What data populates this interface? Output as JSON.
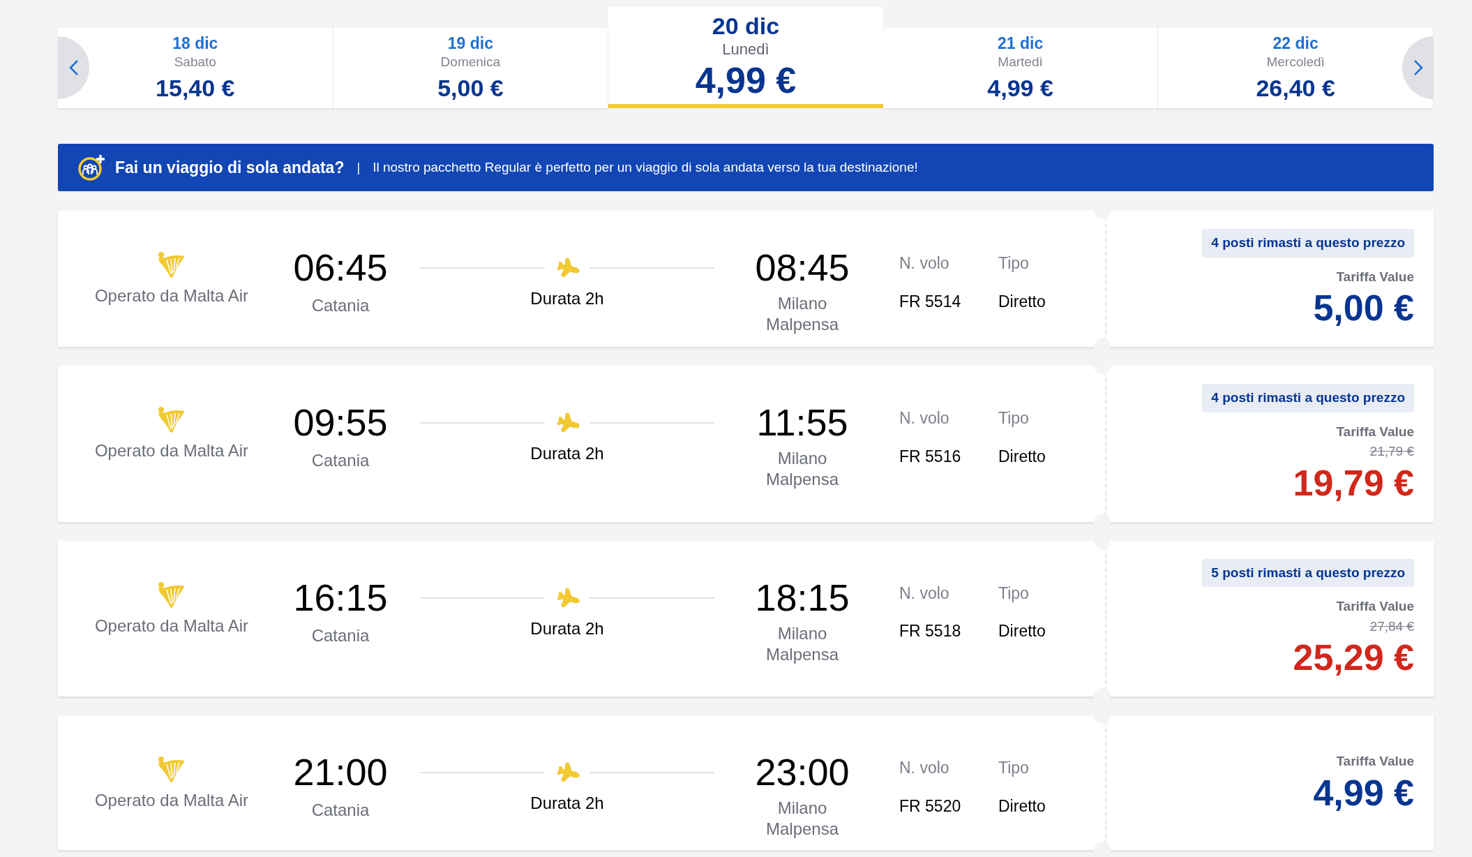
{
  "date_bar": {
    "days": [
      {
        "date": "18 dic",
        "weekday": "Sabato",
        "price": "15,40 €",
        "selected": false
      },
      {
        "date": "19 dic",
        "weekday": "Domenica",
        "price": "5,00 €",
        "selected": false
      },
      {
        "date": "20 dic",
        "weekday": "Lunedì",
        "price": "4,99 €",
        "selected": true
      },
      {
        "date": "21 dic",
        "weekday": "Martedì",
        "price": "4,99 €",
        "selected": false
      },
      {
        "date": "22 dic",
        "weekday": "Mercoledì",
        "price": "26,40 €",
        "selected": false
      }
    ]
  },
  "banner": {
    "title": "Fai un viaggio di sola andata?",
    "separator": "|",
    "text": "Il nostro pacchetto Regular è perfetto per un viaggio di sola andata verso la tua destinazione!"
  },
  "flights": [
    {
      "operator": "Operato da Malta Air",
      "departure_time": "06:45",
      "departure_city": "Catania",
      "duration": "Durata 2h",
      "arrival_time": "08:45",
      "arrival_city": "Milano Malpensa",
      "flight_no_label": "N. volo",
      "flight_no": "FR 5514",
      "type_label": "Tipo",
      "type": "Diretto",
      "seats_badge": "4 posti rimasti a questo prezzo",
      "fare_label": "Tariffa Value",
      "price": "5,00 €",
      "kind": "regular"
    },
    {
      "operator": "Operato da Malta Air",
      "departure_time": "09:55",
      "departure_city": "Catania",
      "duration": "Durata 2h",
      "arrival_time": "11:55",
      "arrival_city": "Milano Malpensa",
      "flight_no_label": "N. volo",
      "flight_no": "FR 5516",
      "type_label": "Tipo",
      "type": "Diretto",
      "seats_badge": "4 posti rimasti a questo prezzo",
      "fare_label": "Tariffa Value",
      "old_price": "21,79 €",
      "price": "19,79 €",
      "kind": "sale"
    },
    {
      "operator": "Operato da Malta Air",
      "departure_time": "16:15",
      "departure_city": "Catania",
      "duration": "Durata 2h",
      "arrival_time": "18:15",
      "arrival_city": "Milano Malpensa",
      "flight_no_label": "N. volo",
      "flight_no": "FR 5518",
      "type_label": "Tipo",
      "type": "Diretto",
      "seats_badge": "5 posti rimasti a questo prezzo",
      "fare_label": "Tariffa Value",
      "old_price": "27,84 €",
      "price": "25,29 €",
      "kind": "sale"
    },
    {
      "operator": "Operato da Malta Air",
      "departure_time": "21:00",
      "departure_city": "Catania",
      "duration": "Durata 2h",
      "arrival_time": "23:00",
      "arrival_city": "Milano Malpensa",
      "flight_no_label": "N. volo",
      "flight_no": "FR 5520",
      "type_label": "Tipo",
      "type": "Diretto",
      "fare_label": "Tariffa Value",
      "price": "4,99 €",
      "kind": "regular"
    }
  ]
}
